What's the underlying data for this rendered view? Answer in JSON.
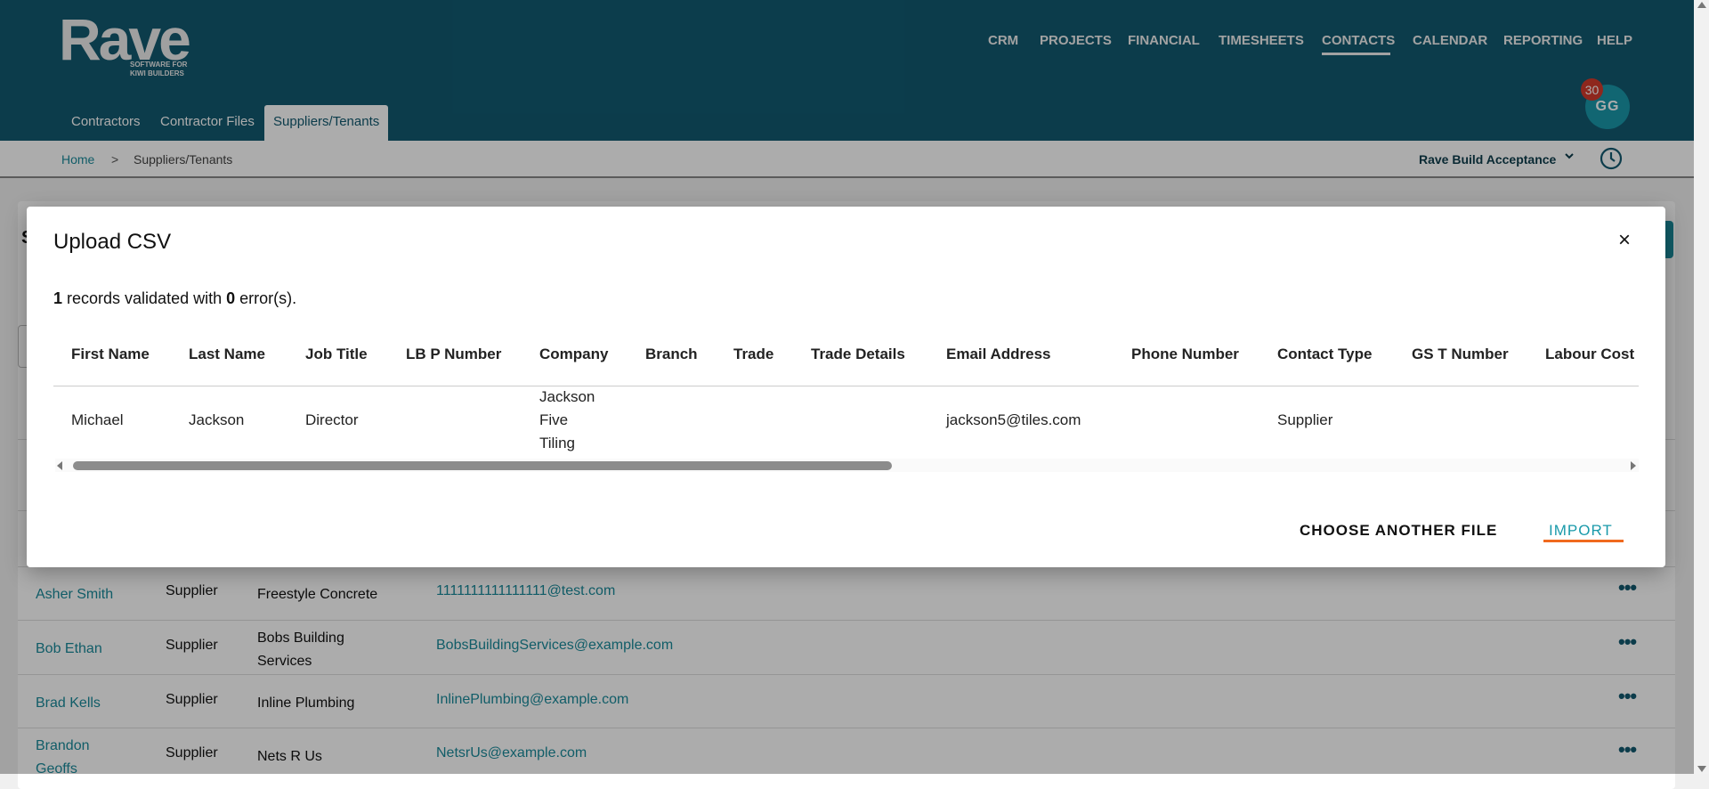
{
  "logo": {
    "main": "Rave",
    "sub1": "SOFTWARE FOR",
    "sub2": "KIWI BUILDERS"
  },
  "nav": [
    "CRM",
    "PROJECTS",
    "FINANCIAL",
    "TIMESHEETS",
    "CONTACTS",
    "CALENDAR",
    "REPORTING",
    "HELP"
  ],
  "active_nav": "CONTACTS",
  "subtabs": [
    "Contractors",
    "Contractor Files",
    "Suppliers/Tenants"
  ],
  "active_subtab": "Suppliers/Tenants",
  "user": {
    "initials": "GG",
    "notifications": "30"
  },
  "breadcrumb": {
    "home": "Home",
    "sep": ">",
    "current": "Suppliers/Tenants"
  },
  "company_selector": "Rave Build Acceptance",
  "background_rows": [
    {
      "name": "Asher Smith",
      "type": "Supplier",
      "company": "Freestyle Concrete",
      "email": "1111111111111111@test.com"
    },
    {
      "name": "Bob Ethan",
      "type": "Supplier",
      "company": "Bobs Building Services",
      "email": "BobsBuildingServices@example.com"
    },
    {
      "name": "Brad Kells",
      "type": "Supplier",
      "company": "Inline Plumbing",
      "email": "InlinePlumbing@example.com"
    },
    {
      "name": "Brandon Geoffs",
      "type": "Supplier",
      "company": "Nets R Us",
      "email": "NetsrUs@example.com"
    }
  ],
  "modal": {
    "title": "Upload CSV",
    "close": "×",
    "records": "1",
    "status_mid": " records validated with ",
    "errors": "0",
    "status_end": " error(s).",
    "columns": [
      "First Name",
      "Last Name",
      "Job Title",
      "LB P Number",
      "Company",
      "Branch",
      "Trade",
      "Trade Details",
      "Email Address",
      "Phone Number",
      "Contact Type",
      "GS T Number",
      "Labour Cost"
    ],
    "rows": [
      [
        "Michael",
        "Jackson",
        "Director",
        "",
        "Jackson Five Tiling",
        "",
        "",
        "",
        "jackson5@tiles.com",
        "",
        "Supplier",
        "",
        ""
      ]
    ],
    "choose_label": "CHOOSE ANOTHER FILE",
    "import_label": "IMPORT"
  },
  "colors": {
    "header": "#125a70",
    "accent": "#1a8a9a",
    "import_underline": "#f06a1e",
    "badge": "#d33a2c"
  }
}
